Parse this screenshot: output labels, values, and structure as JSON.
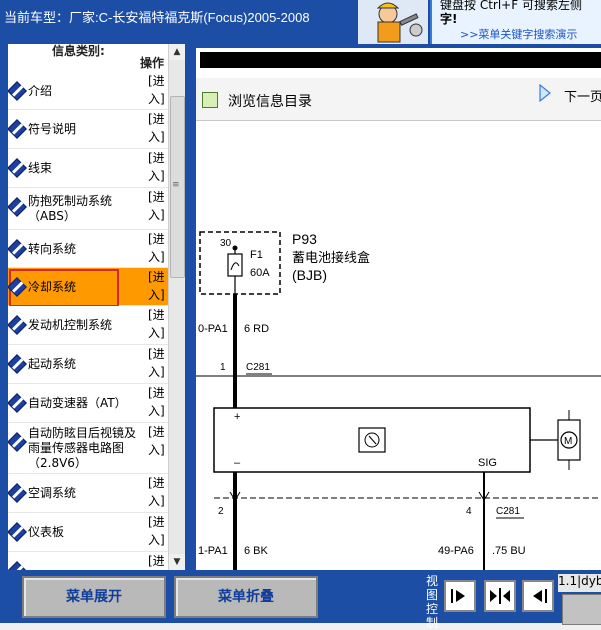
{
  "header": {
    "vehicle": "当前车型：厂家:C-长安福特福克斯(Focus)2005-2008",
    "hint_line1": "键盘按  Ctrl+F  可搜索左侧",
    "hint_line2": "字!",
    "hint_link": ">>菜单关键字搜索演示"
  },
  "list": {
    "category_header": "信息类别:",
    "op_header": "操作",
    "items": [
      {
        "name": "介绍",
        "action": "[进\n入]"
      },
      {
        "name": "符号说明",
        "action": "[进\n入]"
      },
      {
        "name": "线束",
        "action": "[进\n入]"
      },
      {
        "name": "防抱死制动系统\n（ABS）",
        "action": "[进\n入]"
      },
      {
        "name": "转向系统",
        "action": "[进\n入]"
      },
      {
        "name": "冷却系统",
        "action": "[进\n入]"
      },
      {
        "name": "发动机控制系统",
        "action": "[进\n入]"
      },
      {
        "name": "起动系统",
        "action": "[进\n入]"
      },
      {
        "name": "自动变速器（AT）",
        "action": "[进\n入]"
      },
      {
        "name": "自动防眩目后视镜及\n雨量传感器电路图\n（2.8V6）",
        "action": "[进\n入]"
      },
      {
        "name": "空调系统",
        "action": "[进\n入]"
      },
      {
        "name": "仪表板",
        "action": "[进\n入]"
      },
      {
        "name": "",
        "action": "[进"
      }
    ]
  },
  "viewer": {
    "browse_label": "浏览信息目录",
    "next_label": "下一页"
  },
  "diagram": {
    "fuse_num": "30",
    "fuse_id": "F1",
    "fuse_amp": "60A",
    "box_id": "P93",
    "box_name": "蓄电池接线盒",
    "box_code": "(BJB)",
    "wire1_id": "0-PA1",
    "wire1_spec": "6 RD",
    "pin1": "1",
    "conn1": "C281",
    "plus": "+",
    "minus": "–",
    "sig": "SIG",
    "motor": "M",
    "pin2": "2",
    "pin4": "4",
    "conn2": "C281",
    "wire2_id": "1-PA1",
    "wire2_spec": "6 BK",
    "wire3_id": "49-PA6",
    "wire3_spec": ".75 BU"
  },
  "bottom": {
    "expand": "菜单展开",
    "collapse": "菜单折叠",
    "view_control": "视图控制",
    "status": "1.1|dyb"
  },
  "colors": {
    "frame_blue": "#1c4ea6",
    "selected_row": "#ff9900",
    "selection_outline": "#d12a2a"
  }
}
